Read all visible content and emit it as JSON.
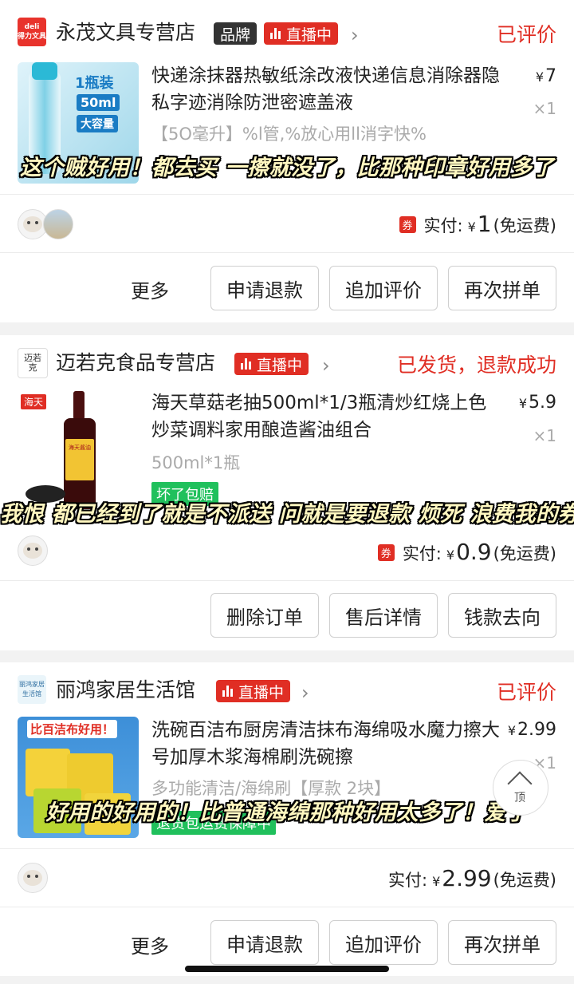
{
  "orders": [
    {
      "shop_logo_text": "deli\n得力文具",
      "shop_name": "永茂文具专营店",
      "brand_tag": "品牌",
      "live_tag": "直播中",
      "status": "已评价",
      "title": "快递涂抹器热敏纸涂改液快递信息消除器隐私字迹消除防泄密遮盖液",
      "spec": "【5O毫升】%l管,%放心用ll消字快%",
      "price_symbol": "¥",
      "price": "7",
      "qty": "×1",
      "caption": "这个贼好用！都去买 一擦就没了，比那种印章好用多了",
      "coupon": "券",
      "paid_label": "实付:",
      "paid_symbol": "¥",
      "paid_amount": "1",
      "paid_note": "(免运费)",
      "thumb_text": [
        "1瓶装",
        "50ml",
        "大容量"
      ],
      "buttons": [
        "更多",
        "申请退款",
        "追加评价",
        "再次拼单"
      ]
    },
    {
      "shop_logo_text": "迈若\n克",
      "shop_name": "迈若克食品专营店",
      "live_tag": "直播中",
      "status": "已发货，退款成功",
      "title": "海天草菇老抽500ml*1/3瓶清炒红烧上色炒菜调料家用酿造酱油组合",
      "spec": "500ml*1瓶",
      "badge": "坏了包赔",
      "price_symbol": "¥",
      "price": "5.9",
      "qty": "×1",
      "caption": "我恨 都已经到了就是不派送 问就是要退款 烦死 浪费我的券",
      "coupon": "券",
      "paid_label": "实付:",
      "paid_symbol": "¥",
      "paid_amount": "0.9",
      "paid_note": "(免运费)",
      "thumb_text": [
        "海天",
        "海天酱油"
      ],
      "buttons": [
        "删除订单",
        "售后详情",
        "钱款去向"
      ]
    },
    {
      "shop_logo_text": "丽鸿家居\n生活馆",
      "shop_name": "丽鸿家居生活馆",
      "live_tag": "直播中",
      "status": "已评价",
      "title": "洗碗百洁布厨房清洁抹布海绵吸水魔力擦大号加厚木浆海棉刷洗碗擦",
      "spec": "多功能清洁/海绵刷【厚款 2块】",
      "badge": "退货包运费保障中",
      "price_symbol": "¥",
      "price": "2.99",
      "qty": "×1",
      "caption": "好用的好用的！比普通海绵那种好用太多了！爱了",
      "paid_label": "实付:",
      "paid_symbol": "¥",
      "paid_amount": "2.99",
      "paid_note": "(免运费)",
      "thumb_text": [
        "比百洁布好用！"
      ],
      "buttons": [
        "更多",
        "申请退款",
        "追加评价",
        "再次拼单"
      ]
    }
  ],
  "scroll_top_label": "顶",
  "colors": {
    "accent_red": "#e02e24",
    "green_badge": "#20c05c",
    "background": "#f2f2f2"
  },
  "icons": [
    "chevron-right-icon",
    "live-bars-icon",
    "chevron-up-icon",
    "coupon-icon"
  ]
}
